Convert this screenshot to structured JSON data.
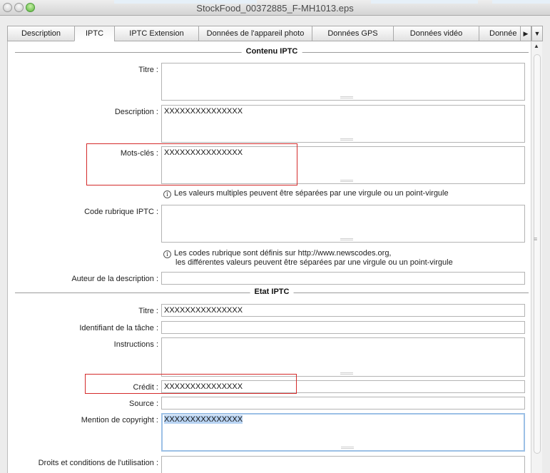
{
  "window": {
    "title": "StockFood_00372885_F-MH1013.eps"
  },
  "tabs": [
    {
      "label": "Description",
      "active": false
    },
    {
      "label": "IPTC",
      "active": true
    },
    {
      "label": "IPTC Extension",
      "active": false
    },
    {
      "label": "Données de l'appareil photo",
      "active": false
    },
    {
      "label": "Données GPS",
      "active": false
    },
    {
      "label": "Données vidéo",
      "active": false
    },
    {
      "label": "Donnée",
      "active": false
    }
  ],
  "icons": {
    "tab_more": "triangle-right-icon",
    "menu": "triangle-down-icon",
    "scroll_up": "triangle-up-icon",
    "info": "info-icon"
  },
  "sections": {
    "contenu": "Contenu IPTC",
    "etat": "Etat IPTC"
  },
  "contenu": {
    "titre_label": "Titre :",
    "titre_value": "",
    "description_label": "Description :",
    "description_value": "XXXXXXXXXXXXXXX",
    "mots_cles_label": "Mots-clés :",
    "mots_cles_value": "XXXXXXXXXXXXXXX",
    "mots_cles_hint": "Les valeurs multiples peuvent être séparées par une virgule ou un point-virgule",
    "code_rubrique_label": "Code rubrique IPTC :",
    "code_rubrique_value": "",
    "code_rubrique_hint_1": "Les codes rubrique sont définis sur http://www.newscodes.org,",
    "code_rubrique_hint_2": "les différentes valeurs peuvent être séparées par une virgule ou un point-virgule",
    "auteur_label": "Auteur de la description :",
    "auteur_value": ""
  },
  "etat": {
    "titre_label": "Titre :",
    "titre_value": "XXXXXXXXXXXXXXX",
    "identifiant_label": "Identifiant de la tâche :",
    "identifiant_value": "",
    "instructions_label": "Instructions :",
    "instructions_value": "",
    "credit_label": "Crédit :",
    "credit_value": "XXXXXXXXXXXXXXX",
    "source_label": "Source :",
    "source_value": "",
    "copyright_label": "Mention de copyright :",
    "copyright_value": "XXXXXXXXXXXXXXX",
    "droits_label": "Droits et conditions de l'utilisation :",
    "droits_value": ""
  },
  "colors": {
    "highlight_box": "#d42a2a",
    "focus_ring": "#9cc0e6",
    "selection": "#b8d3f2"
  }
}
